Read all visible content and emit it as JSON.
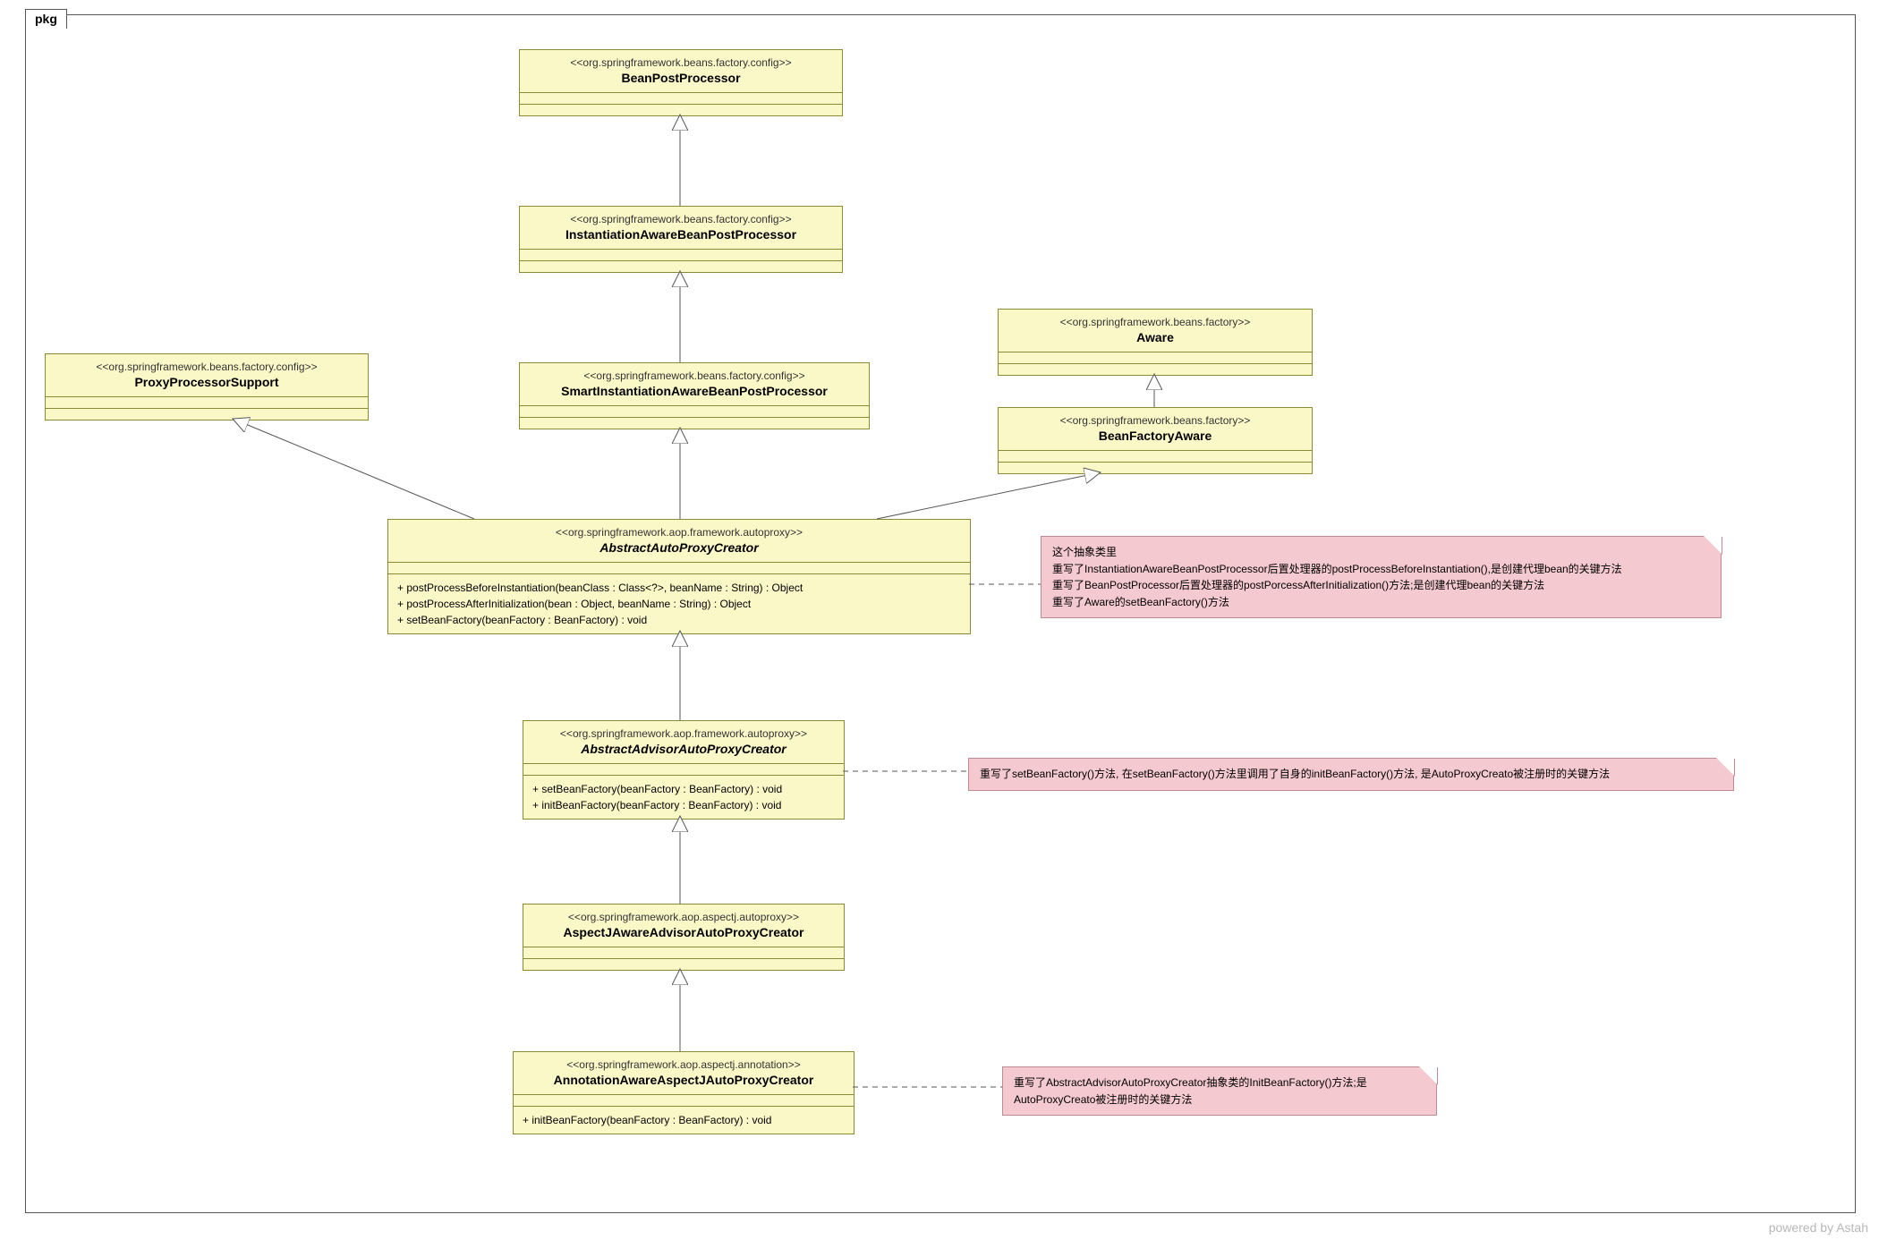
{
  "pkg_label": "pkg",
  "watermark": "powered by Astah",
  "classes": {
    "bpp": {
      "stereo": "<<org.springframework.beans.factory.config>>",
      "name": "BeanPostProcessor"
    },
    "iabpp": {
      "stereo": "<<org.springframework.beans.factory.config>>",
      "name": "InstantiationAwareBeanPostProcessor"
    },
    "siabpp": {
      "stereo": "<<org.springframework.beans.factory.config>>",
      "name": "SmartInstantiationAwareBeanPostProcessor"
    },
    "pps": {
      "stereo": "<<org.springframework.beans.factory.config>>",
      "name": "ProxyProcessorSupport"
    },
    "aware": {
      "stereo": "<<org.springframework.beans.factory>>",
      "name": "Aware"
    },
    "bfa": {
      "stereo": "<<org.springframework.beans.factory>>",
      "name": "BeanFactoryAware"
    },
    "aapc": {
      "stereo": "<<org.springframework.aop.framework.autoproxy>>",
      "name": "AbstractAutoProxyCreator",
      "italic": true,
      "ops": [
        "+ postProcessBeforeInstantiation(beanClass : Class<?>, beanName : String) : Object",
        "+ postProcessAfterInitialization(bean : Object, beanName : String) : Object",
        "+ setBeanFactory(beanFactory : BeanFactory) : void"
      ]
    },
    "aaapc": {
      "stereo": "<<org.springframework.aop.framework.autoproxy>>",
      "name": "AbstractAdvisorAutoProxyCreator",
      "italic": true,
      "ops": [
        "+ setBeanFactory(beanFactory : BeanFactory) : void",
        "+ initBeanFactory(beanFactory : BeanFactory) : void"
      ]
    },
    "aja": {
      "stereo": "<<org.springframework.aop.aspectj.autoproxy>>",
      "name": "AspectJAwareAdvisorAutoProxyCreator"
    },
    "aaajapc": {
      "stereo": "<<org.springframework.aop.aspectj.annotation>>",
      "name": "AnnotationAwareAspectJAutoProxyCreator",
      "ops": [
        "+ initBeanFactory(beanFactory : BeanFactory) : void"
      ]
    }
  },
  "notes": {
    "n1": {
      "l1": "这个抽象类里",
      "l2": "重写了InstantiationAwareBeanPostProcessor后置处理器的postProcessBeforeInstantiation(),是创建代理bean的关键方法",
      "l3": "重写了BeanPostProcessor后置处理器的postPorcessAfterInitialization()方法;是创建代理bean的关键方法",
      "l4": "重写了Aware的setBeanFactory()方法"
    },
    "n2": "重写了setBeanFactory()方法, 在setBeanFactory()方法里调用了自身的initBeanFactory()方法, 是AutoProxyCreato被注册时的关键方法",
    "n3": "重写了AbstractAdvisorAutoProxyCreator抽象类的InitBeanFactory()方法;是AutoProxyCreato被注册时的关键方法"
  }
}
